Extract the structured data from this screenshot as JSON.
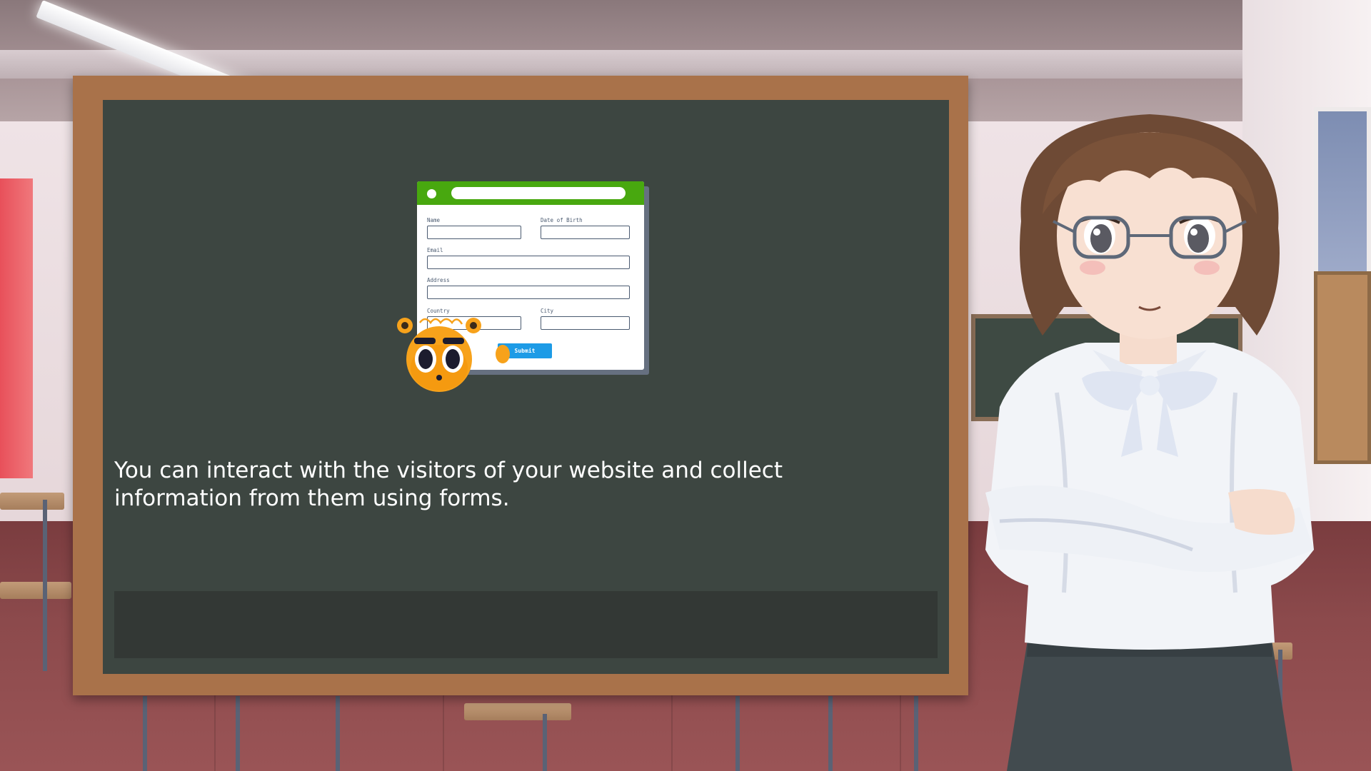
{
  "lesson": {
    "text": "You can interact with the visitors of your website and collect information from them using forms."
  },
  "form_illustration": {
    "fields": {
      "name": "Name",
      "dob": "Date of Birth",
      "email": "Email",
      "address": "Address",
      "country": "Country",
      "city": "City"
    },
    "submit_label": "Submit"
  },
  "colors": {
    "board": "#3d4641",
    "board_frame": "#a9724a",
    "form_header": "#48a80f",
    "submit": "#1d9be6",
    "mascot": "#f7a21b"
  }
}
